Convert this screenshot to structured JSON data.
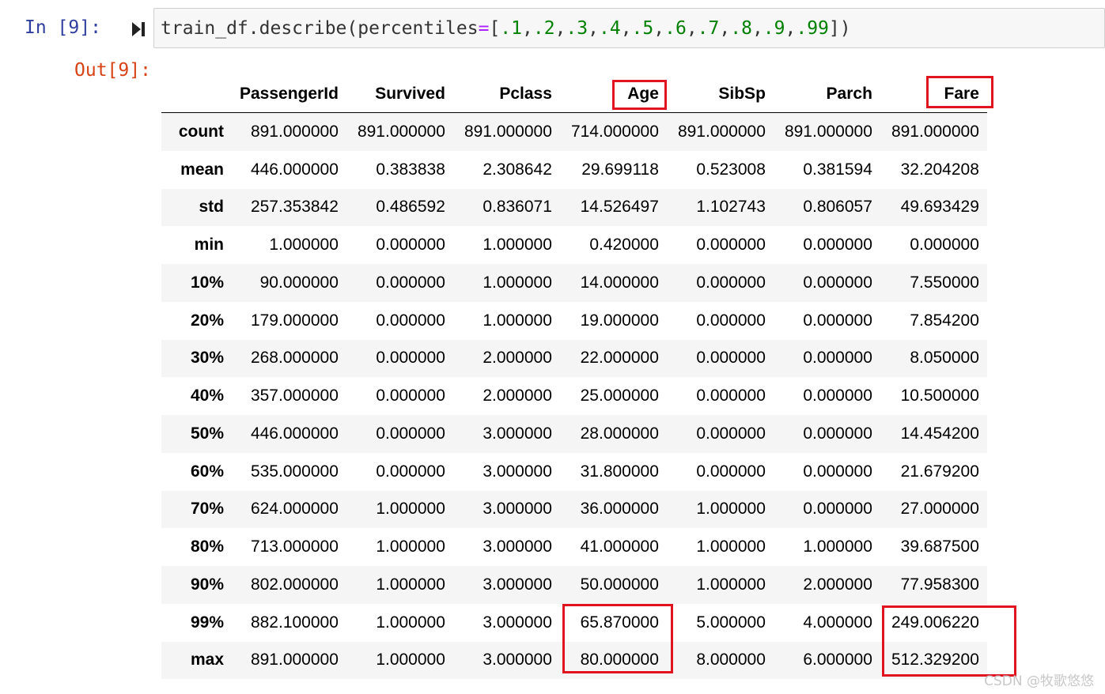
{
  "cell": {
    "in_prompt": "In  [9]:",
    "out_prompt": "Out[9]:",
    "code": {
      "obj": "train_df.describe(percentiles",
      "eq": "=",
      "lbr": "[",
      "nums": [
        ".1",
        ".2",
        ".3",
        ".4",
        ".5",
        ".6",
        ".7",
        ".8",
        ".9",
        ".99"
      ],
      "sep": ",",
      "rbr": "])"
    }
  },
  "table": {
    "columns": [
      "PassengerId",
      "Survived",
      "Pclass",
      "Age",
      "SibSp",
      "Parch",
      "Fare"
    ],
    "rows": [
      {
        "label": "count",
        "values": [
          "891.000000",
          "891.000000",
          "891.000000",
          "714.000000",
          "891.000000",
          "891.000000",
          "891.000000"
        ]
      },
      {
        "label": "mean",
        "values": [
          "446.000000",
          "0.383838",
          "2.308642",
          "29.699118",
          "0.523008",
          "0.381594",
          "32.204208"
        ]
      },
      {
        "label": "std",
        "values": [
          "257.353842",
          "0.486592",
          "0.836071",
          "14.526497",
          "1.102743",
          "0.806057",
          "49.693429"
        ]
      },
      {
        "label": "min",
        "values": [
          "1.000000",
          "0.000000",
          "1.000000",
          "0.420000",
          "0.000000",
          "0.000000",
          "0.000000"
        ]
      },
      {
        "label": "10%",
        "values": [
          "90.000000",
          "0.000000",
          "1.000000",
          "14.000000",
          "0.000000",
          "0.000000",
          "7.550000"
        ]
      },
      {
        "label": "20%",
        "values": [
          "179.000000",
          "0.000000",
          "1.000000",
          "19.000000",
          "0.000000",
          "0.000000",
          "7.854200"
        ]
      },
      {
        "label": "30%",
        "values": [
          "268.000000",
          "0.000000",
          "2.000000",
          "22.000000",
          "0.000000",
          "0.000000",
          "8.050000"
        ]
      },
      {
        "label": "40%",
        "values": [
          "357.000000",
          "0.000000",
          "2.000000",
          "25.000000",
          "0.000000",
          "0.000000",
          "10.500000"
        ]
      },
      {
        "label": "50%",
        "values": [
          "446.000000",
          "0.000000",
          "3.000000",
          "28.000000",
          "0.000000",
          "0.000000",
          "14.454200"
        ]
      },
      {
        "label": "60%",
        "values": [
          "535.000000",
          "0.000000",
          "3.000000",
          "31.800000",
          "0.000000",
          "0.000000",
          "21.679200"
        ]
      },
      {
        "label": "70%",
        "values": [
          "624.000000",
          "1.000000",
          "3.000000",
          "36.000000",
          "1.000000",
          "0.000000",
          "27.000000"
        ]
      },
      {
        "label": "80%",
        "values": [
          "713.000000",
          "1.000000",
          "3.000000",
          "41.000000",
          "1.000000",
          "1.000000",
          "39.687500"
        ]
      },
      {
        "label": "90%",
        "values": [
          "802.000000",
          "1.000000",
          "3.000000",
          "50.000000",
          "1.000000",
          "2.000000",
          "77.958300"
        ]
      },
      {
        "label": "99%",
        "values": [
          "882.100000",
          "1.000000",
          "3.000000",
          "65.870000",
          "5.000000",
          "4.000000",
          "249.006220"
        ]
      },
      {
        "label": "max",
        "values": [
          "891.000000",
          "1.000000",
          "3.000000",
          "80.000000",
          "8.000000",
          "6.000000",
          "512.329200"
        ]
      }
    ]
  },
  "annotations": {
    "highlight_color": "#e0141e",
    "highlighted": [
      "Age",
      "Fare"
    ]
  },
  "watermark": "CSDN @牧歌悠悠",
  "colors": {
    "in_prompt": "#303f9f",
    "out_prompt": "#d84315",
    "code_operator": "#aa22ff",
    "code_number": "#008000"
  }
}
